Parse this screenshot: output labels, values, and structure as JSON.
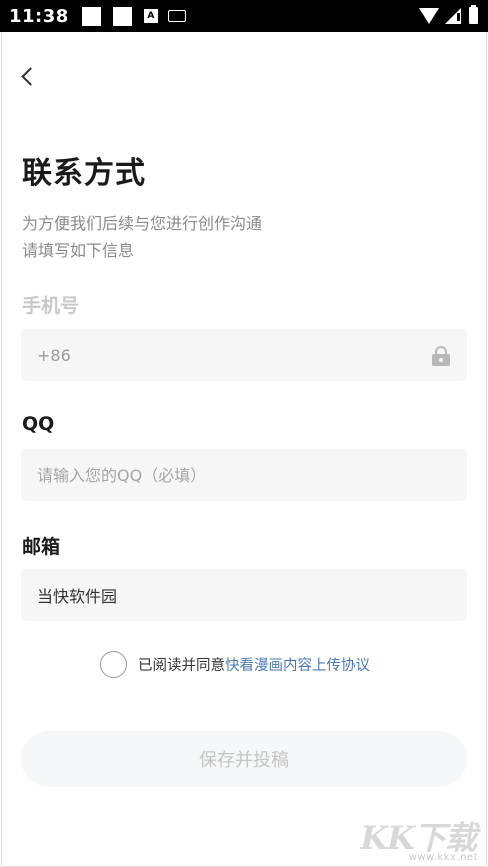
{
  "status_bar": {
    "time": "11:38",
    "notif_letter": "A"
  },
  "page": {
    "title": "联系方式",
    "subtitle_line1": "为方便我们后续与您进行创作沟通",
    "subtitle_line2": "请填写如下信息"
  },
  "phone": {
    "label": "手机号",
    "value": "+86"
  },
  "qq": {
    "label": "QQ",
    "placeholder": "请输入您的QQ（必填）"
  },
  "email": {
    "label": "邮箱",
    "value": "当快软件园"
  },
  "agreement": {
    "prefix": "已阅读并同意",
    "link": "快看漫画内容上传协议"
  },
  "submit": {
    "label": "保存并投稿"
  },
  "watermark": {
    "letters": "KK下载",
    "url": "www.kkx.net"
  },
  "icons": [
    "back-arrow-icon",
    "lock-icon",
    "wifi-icon",
    "signal-icon",
    "battery-icon",
    "keyboard-icon"
  ]
}
